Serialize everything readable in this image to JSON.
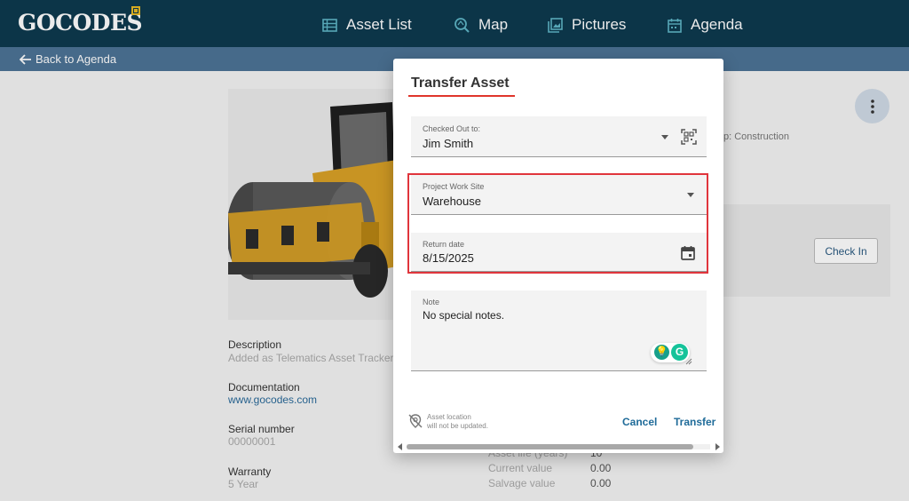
{
  "brand": {
    "logo_text": "GOCODES"
  },
  "nav": [
    {
      "label": "Asset List",
      "icon": "list-icon"
    },
    {
      "label": "Map",
      "icon": "map-search-icon"
    },
    {
      "label": "Pictures",
      "icon": "pictures-icon"
    },
    {
      "label": "Agenda",
      "icon": "calendar-icon"
    }
  ],
  "subbar": {
    "back_label": "Back to Agenda"
  },
  "asset": {
    "image_alt": "road roller",
    "group_text": "p: Construction",
    "checkin_label": "Check In",
    "details": [
      {
        "label": "Description",
        "value": "Added as Telematics Asset Tracker1"
      },
      {
        "label": "Documentation",
        "value": "www.gocodes.com"
      },
      {
        "label": "Serial number",
        "value": "00000001"
      },
      {
        "label": "Warranty",
        "value": "5 Year"
      }
    ],
    "financial": [
      {
        "label": "Asset life (years)",
        "value": "10"
      },
      {
        "label": "Current value",
        "value": "0.00"
      },
      {
        "label": "Salvage value",
        "value": "0.00"
      }
    ]
  },
  "dialog": {
    "title": "Transfer Asset",
    "checked_out": {
      "label": "Checked Out to:",
      "value": "Jim Smith"
    },
    "work_site": {
      "label": "Project Work Site",
      "value": "Warehouse"
    },
    "return_date": {
      "label": "Return date",
      "value": "8/15/2025"
    },
    "note": {
      "label": "Note",
      "value": "No special notes."
    },
    "location_line1": "Asset location",
    "location_line2": "will not be updated.",
    "cancel_label": "Cancel",
    "transfer_label": "Transfer"
  },
  "colors": {
    "topbar": "#0e3a4f",
    "subbar": "#4d7396",
    "accent_red": "#e0352b",
    "link_blue": "#1f6b99",
    "logo_gold": "#e8b923"
  }
}
